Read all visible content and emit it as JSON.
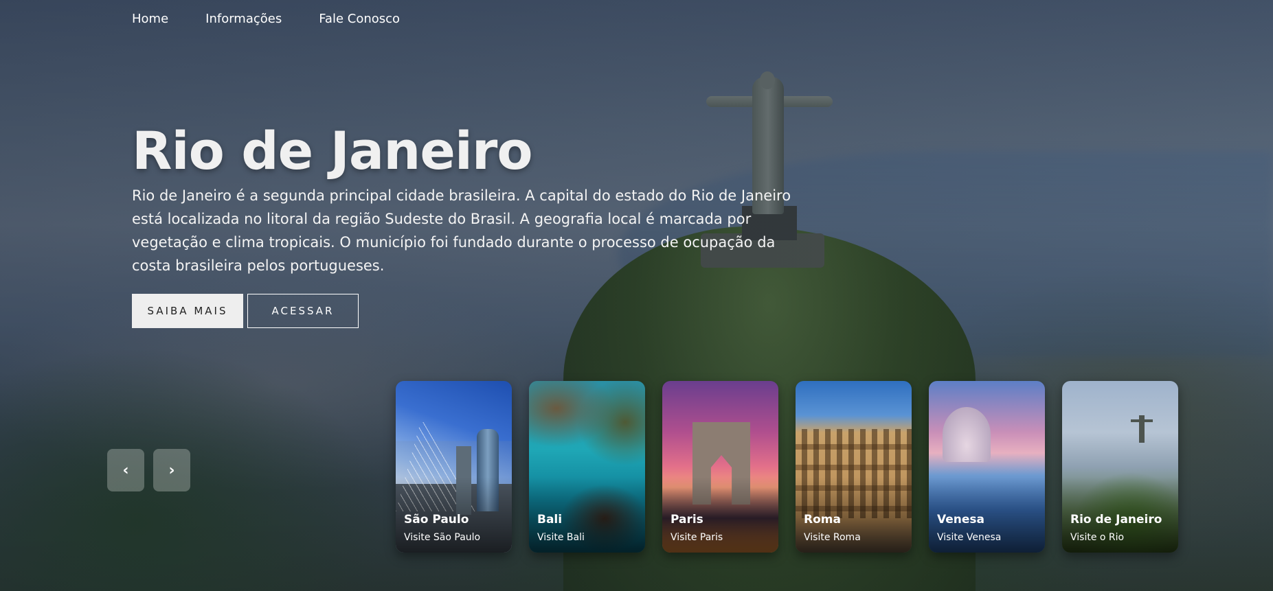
{
  "nav": {
    "items": [
      {
        "label": "Home"
      },
      {
        "label": "Informações"
      },
      {
        "label": "Fale Conosco"
      }
    ]
  },
  "hero": {
    "title": "Rio de Janeiro",
    "description": "Rio de Janeiro é a segunda principal cidade brasileira. A capital do estado do Rio de Janeiro está localizada no litoral da região Sudeste do Brasil. A geografia local é marcada por vegetação e clima tropicais. O município foi fundado durante o processo de ocupação da costa brasileira pelos portugueses.",
    "primary_button": "SAIBA MAIS",
    "secondary_button": "ACESSAR"
  },
  "slider": {
    "prev_icon": "‹",
    "next_icon": "›"
  },
  "cards": [
    {
      "title": "São Paulo",
      "subtitle": "Visite São Paulo"
    },
    {
      "title": "Bali",
      "subtitle": "Visite Bali"
    },
    {
      "title": "Paris",
      "subtitle": "Visite Paris"
    },
    {
      "title": "Roma",
      "subtitle": "Visite Roma"
    },
    {
      "title": "Venesa",
      "subtitle": "Visite Venesa"
    },
    {
      "title": "Rio de Janeiro",
      "subtitle": "Visite o Rio"
    }
  ]
}
